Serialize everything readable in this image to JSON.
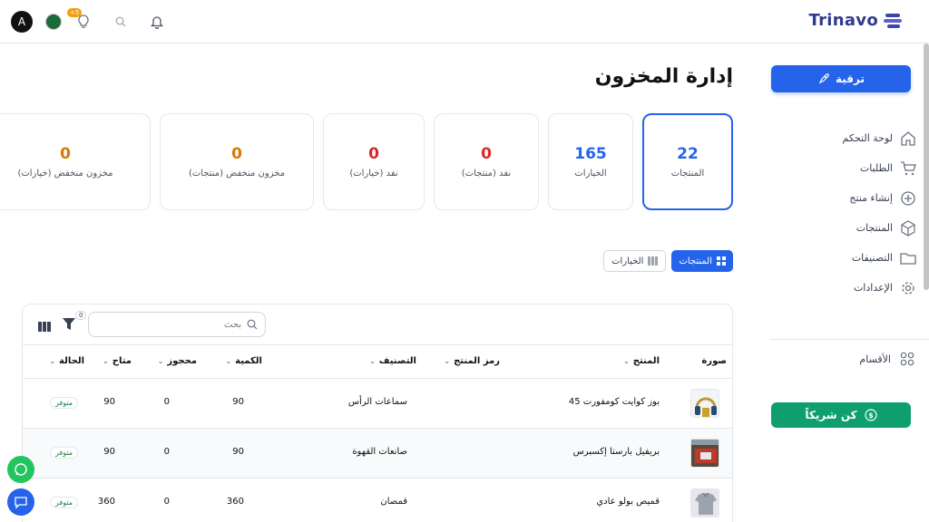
{
  "brand": {
    "name": "Trinavo"
  },
  "topbar": {
    "avatar_letter": "A",
    "notification_badge": "+5"
  },
  "sidebar": {
    "upgrade_label": "ترقية",
    "items": [
      {
        "label": "لوحة التحكم",
        "icon": "home-icon"
      },
      {
        "label": "الطلبات",
        "icon": "cart-icon"
      },
      {
        "label": "إنشاء منتج",
        "icon": "plus-circle-icon"
      },
      {
        "label": "المنتجات",
        "icon": "box-icon"
      },
      {
        "label": "التصنيفات",
        "icon": "folder-icon"
      },
      {
        "label": "الإعدادات",
        "icon": "gear-icon"
      }
    ],
    "sections_label": "الأقسام",
    "partner_label": "كن شريكاً"
  },
  "page": {
    "title": "إدارة المخزون"
  },
  "cards": [
    {
      "value": "22",
      "label": "المنتجات",
      "color": "#2563eb",
      "active": true
    },
    {
      "value": "165",
      "label": "الخيارات",
      "color": "#2563eb",
      "active": false
    },
    {
      "value": "0",
      "label": "نفد (منتجات)",
      "color": "#dc2626",
      "active": false
    },
    {
      "value": "0",
      "label": "نفد (خيارات)",
      "color": "#dc2626",
      "active": false
    },
    {
      "value": "0",
      "label": "مخزون منخفض (منتجات)",
      "color": "#d97706",
      "active": false
    },
    {
      "value": "0",
      "label": "مخزون منخفض (خيارات)",
      "color": "#d97706",
      "active": false
    }
  ],
  "tabs": {
    "products": "المنتجات",
    "options": "الخيارات"
  },
  "table": {
    "search_placeholder": "بحث",
    "filter_count": "0",
    "headers": {
      "image": "صورة",
      "product": "المنتج",
      "sku": "رمز المنتج",
      "category": "التصنيف",
      "quantity": "الكمية",
      "reserved": "محجوز",
      "available": "متاح",
      "status": "الحالة"
    },
    "rows": [
      {
        "product": "بوز كوايت كومفورت 45",
        "category": "سماعات الرأس",
        "quantity": "90",
        "reserved": "0",
        "available": "90",
        "status": "متوفر"
      },
      {
        "product": "بريفيل بارستا إكسبرس",
        "category": "صانعات القهوة",
        "quantity": "90",
        "reserved": "0",
        "available": "90",
        "status": "متوفر"
      },
      {
        "product": "قميص بولو عادي",
        "category": "قمصان",
        "quantity": "360",
        "reserved": "0",
        "available": "360",
        "status": "متوفر"
      }
    ]
  },
  "colors": {
    "primary": "#2563eb",
    "success": "#0f9f6e",
    "danger": "#dc2626",
    "warning": "#d97706"
  }
}
